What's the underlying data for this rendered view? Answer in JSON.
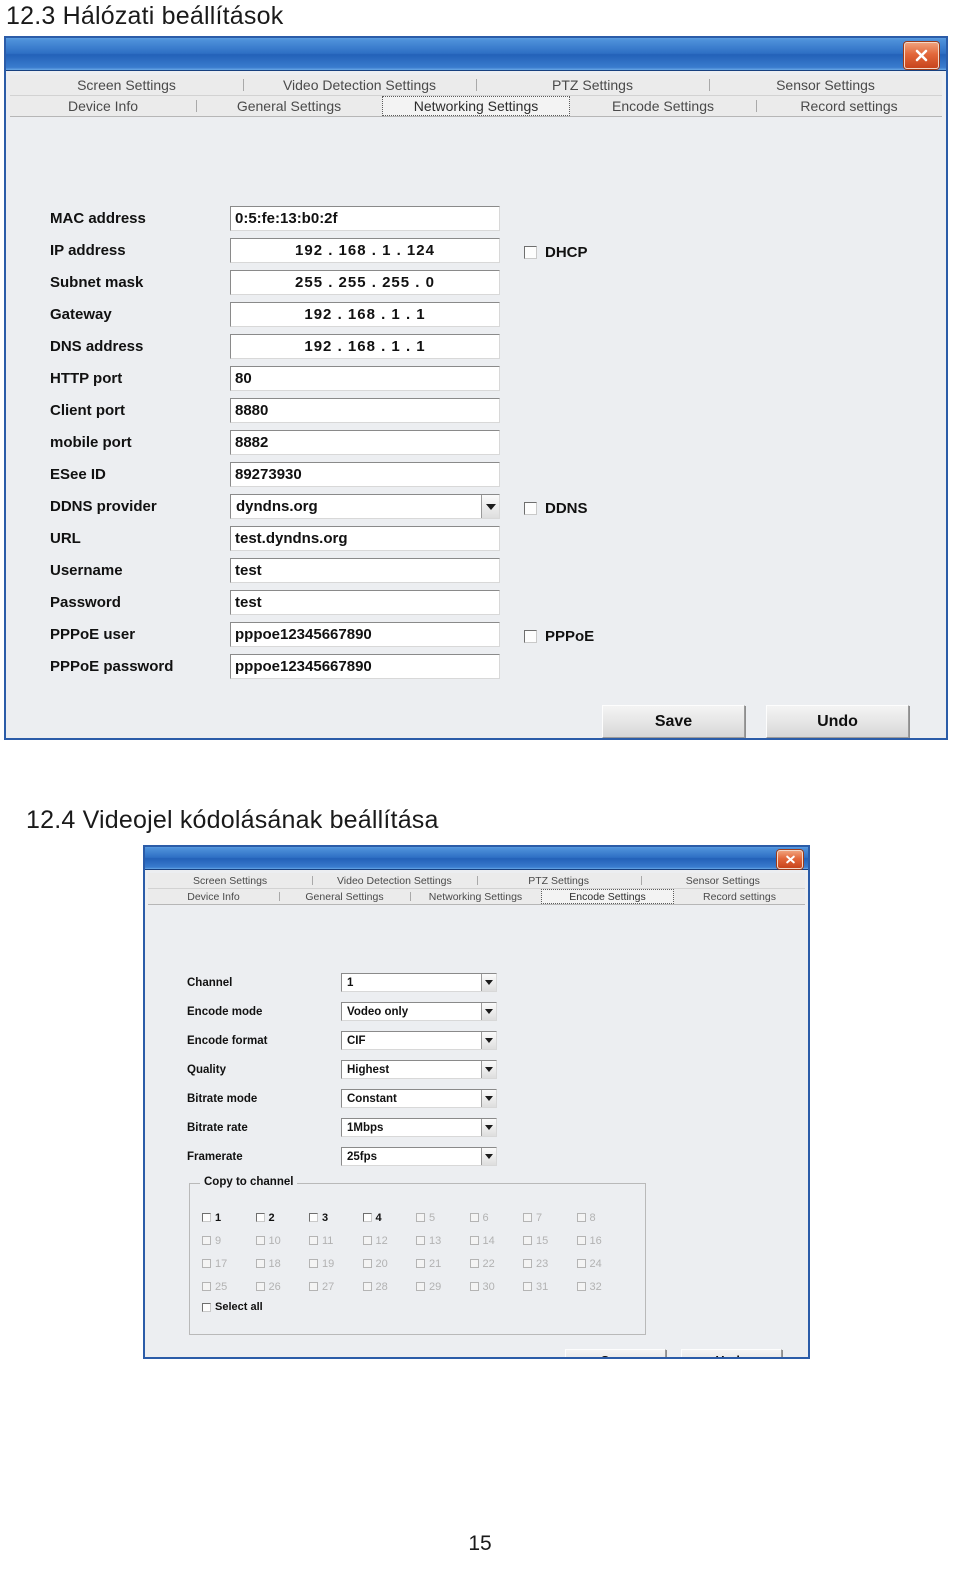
{
  "document": {
    "heading_123": "12.3 Hálózati beállítások",
    "heading_124": "12.4 Videojel kódolásának beállítása",
    "page_number": "15"
  },
  "colors": {
    "title_bar": "#2361b8",
    "dialog_border": "#2b5ca8",
    "dialog_face": "#eceef1",
    "close_button": "#c8441c"
  },
  "network_dialog": {
    "title": "",
    "close_icon": "close-icon",
    "tabs_row1": [
      {
        "label": "Screen Settings",
        "selected": false
      },
      {
        "label": "Video Detection Settings",
        "selected": false
      },
      {
        "label": "PTZ Settings",
        "selected": false
      },
      {
        "label": "Sensor Settings",
        "selected": false
      }
    ],
    "tabs_row2": [
      {
        "label": "Device Info",
        "selected": false
      },
      {
        "label": "General Settings",
        "selected": false
      },
      {
        "label": "Networking Settings",
        "selected": true
      },
      {
        "label": "Encode Settings",
        "selected": false
      },
      {
        "label": "Record settings",
        "selected": false
      }
    ],
    "fields": {
      "mac_address": {
        "label": "MAC address",
        "value": "0:5:fe:13:b0:2f"
      },
      "ip_address": {
        "label": "IP address",
        "value": "192 .  168 .    1    . 124"
      },
      "subnet_mask": {
        "label": "Subnet mask",
        "value": "255 .  255 .  255 .    0"
      },
      "gateway": {
        "label": "Gateway",
        "value": "192 .  168 .    1    .    1"
      },
      "dns_address": {
        "label": "DNS address",
        "value": "192 .  168 .    1    .    1"
      },
      "http_port": {
        "label": "HTTP port",
        "value": "80"
      },
      "client_port": {
        "label": " Client port",
        "value": "8880"
      },
      "mobile_port": {
        "label": "mobile port",
        "value": "8882"
      },
      "esee_id": {
        "label": "ESee ID",
        "value": "89273930"
      },
      "ddns_provider": {
        "label": "DDNS provider",
        "value": "dyndns.org"
      },
      "url": {
        "label": "URL",
        "value": "test.dyndns.org"
      },
      "username": {
        "label": "Username",
        "value": "test"
      },
      "password": {
        "label": "Password",
        "value": "test"
      },
      "pppoe_user": {
        "label": "PPPoE user",
        "value": "pppoe12345667890"
      },
      "pppoe_password": {
        "label": "PPPoE password",
        "value": "pppoe12345667890"
      }
    },
    "checkboxes": {
      "dhcp": {
        "label": "DHCP",
        "checked": false
      },
      "ddns": {
        "label": "DDNS",
        "checked": false
      },
      "pppoe": {
        "label": "PPPoE",
        "checked": false
      }
    },
    "buttons": {
      "save": "Save",
      "undo": "Undo"
    }
  },
  "encode_dialog": {
    "title": "",
    "close_icon": "close-icon",
    "tabs_row1": [
      {
        "label": "Screen Settings",
        "selected": false
      },
      {
        "label": "Video Detection Settings",
        "selected": false
      },
      {
        "label": "PTZ Settings",
        "selected": false
      },
      {
        "label": "Sensor Settings",
        "selected": false
      }
    ],
    "tabs_row2": [
      {
        "label": "Device Info",
        "selected": false
      },
      {
        "label": "General Settings",
        "selected": false
      },
      {
        "label": "Networking Settings",
        "selected": false
      },
      {
        "label": "Encode Settings",
        "selected": true
      },
      {
        "label": "Record settings",
        "selected": false
      }
    ],
    "fields": {
      "channel": {
        "label": "Channel",
        "value": "1"
      },
      "encode_mode": {
        "label": "Encode mode",
        "value": "Vodeo only"
      },
      "encode_format": {
        "label": "Encode format",
        "value": "CIF"
      },
      "quality": {
        "label": "Quality",
        "value": "Highest"
      },
      "bitrate_mode": {
        "label": "Bitrate mode",
        "value": "Constant"
      },
      "bitrate_rate": {
        "label": "Bitrate rate",
        "value": "1Mbps"
      },
      "framerate": {
        "label": "Framerate",
        "value": "25fps"
      }
    },
    "copy_to_channel": {
      "title": "Copy to channel",
      "select_all": {
        "label": "Select all",
        "checked": false
      },
      "channels": [
        {
          "label": "1",
          "checked": false,
          "enabled": true
        },
        {
          "label": "2",
          "checked": false,
          "enabled": true
        },
        {
          "label": "3",
          "checked": false,
          "enabled": true
        },
        {
          "label": "4",
          "checked": false,
          "enabled": true
        },
        {
          "label": "5",
          "checked": false,
          "enabled": false
        },
        {
          "label": "6",
          "checked": false,
          "enabled": false
        },
        {
          "label": "7",
          "checked": false,
          "enabled": false
        },
        {
          "label": "8",
          "checked": false,
          "enabled": false
        },
        {
          "label": "9",
          "checked": false,
          "enabled": false
        },
        {
          "label": "10",
          "checked": false,
          "enabled": false
        },
        {
          "label": "11",
          "checked": false,
          "enabled": false
        },
        {
          "label": "12",
          "checked": false,
          "enabled": false
        },
        {
          "label": "13",
          "checked": false,
          "enabled": false
        },
        {
          "label": "14",
          "checked": false,
          "enabled": false
        },
        {
          "label": "15",
          "checked": false,
          "enabled": false
        },
        {
          "label": "16",
          "checked": false,
          "enabled": false
        },
        {
          "label": "17",
          "checked": false,
          "enabled": false
        },
        {
          "label": "18",
          "checked": false,
          "enabled": false
        },
        {
          "label": "19",
          "checked": false,
          "enabled": false
        },
        {
          "label": "20",
          "checked": false,
          "enabled": false
        },
        {
          "label": "21",
          "checked": false,
          "enabled": false
        },
        {
          "label": "22",
          "checked": false,
          "enabled": false
        },
        {
          "label": "23",
          "checked": false,
          "enabled": false
        },
        {
          "label": "24",
          "checked": false,
          "enabled": false
        },
        {
          "label": "25",
          "checked": false,
          "enabled": false
        },
        {
          "label": "26",
          "checked": false,
          "enabled": false
        },
        {
          "label": "27",
          "checked": false,
          "enabled": false
        },
        {
          "label": "28",
          "checked": false,
          "enabled": false
        },
        {
          "label": "29",
          "checked": false,
          "enabled": false
        },
        {
          "label": "30",
          "checked": false,
          "enabled": false
        },
        {
          "label": "31",
          "checked": false,
          "enabled": false
        },
        {
          "label": "32",
          "checked": false,
          "enabled": false
        }
      ]
    },
    "buttons": {
      "save": "Save",
      "undo": "Undo"
    }
  }
}
